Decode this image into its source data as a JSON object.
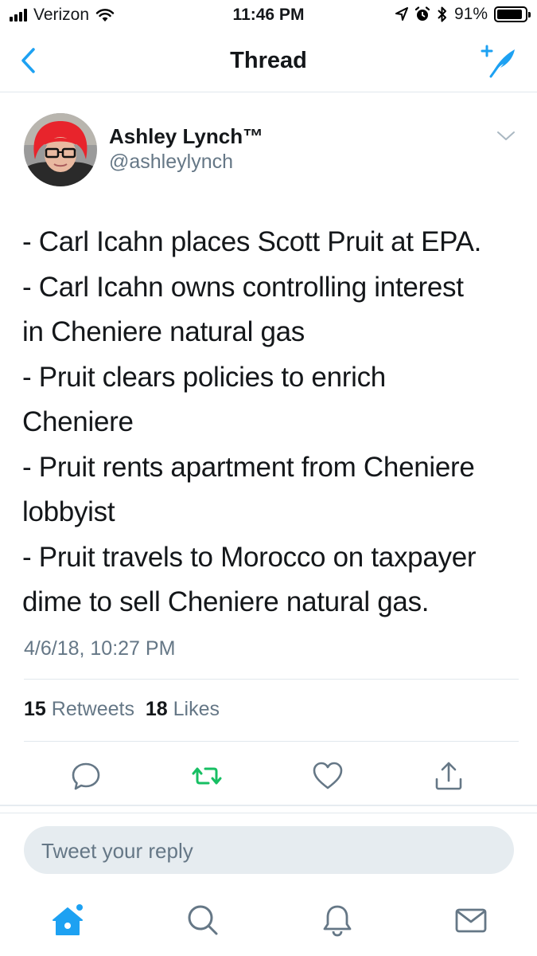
{
  "status_bar": {
    "carrier": "Verizon",
    "time": "11:46 PM",
    "battery_percent": "91%",
    "battery_level": 0.91,
    "icons": [
      "signal-icon",
      "wifi-icon",
      "location-icon",
      "alarm-icon",
      "bluetooth-icon",
      "battery-icon"
    ]
  },
  "nav": {
    "title": "Thread",
    "back_icon": "chevron-left-icon",
    "compose_icon": "compose-feather-icon"
  },
  "tweet": {
    "author_name": "Ashley Lynch™",
    "author_handle": "@ashleylynch",
    "lines": [
      "- Carl Icahn places Scott Pruit at EPA.",
      "- Carl Icahn owns controlling interest",
      "in Cheniere natural gas",
      "- Pruit clears policies to enrich",
      "Cheniere",
      "- Pruit rents apartment from Cheniere",
      "lobbyist",
      "- Pruit travels to Morocco on taxpayer",
      "dime to sell Cheniere natural gas."
    ],
    "timestamp": "4/6/18, 10:27 PM",
    "retweets_count": "15",
    "retweets_label": "Retweets",
    "likes_count": "18",
    "likes_label": "Likes"
  },
  "actions": [
    "reply-icon",
    "retweet-icon",
    "like-icon",
    "share-icon"
  ],
  "reply": {
    "placeholder": "Tweet your reply"
  },
  "tab_bar": [
    "home-icon",
    "search-icon",
    "notifications-icon",
    "messages-icon"
  ],
  "colors": {
    "accent": "#1da1f2",
    "retweet_green": "#17bf63",
    "secondary_text": "#657786",
    "divider": "#e1e8ed",
    "reply_bg": "#e6ecf0"
  }
}
